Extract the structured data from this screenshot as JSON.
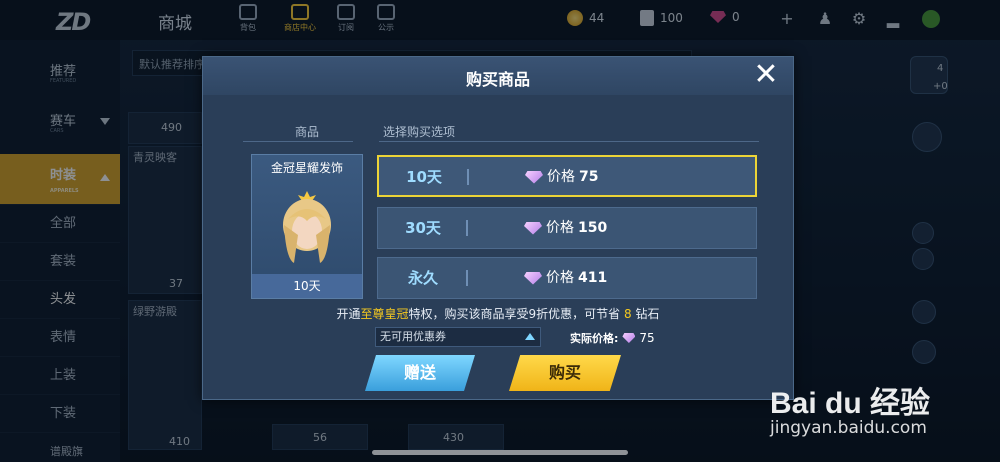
{
  "topbar": {
    "title": "商城",
    "tabs": [
      {
        "label": "背包"
      },
      {
        "label": "商店中心"
      },
      {
        "label": "订阅"
      },
      {
        "label": "公示"
      }
    ],
    "coins": "44",
    "tickets": "100",
    "diamonds": "0"
  },
  "sidebar": {
    "items": [
      {
        "label": "推荐",
        "sub": "FEATURED"
      },
      {
        "label": "赛车",
        "sub": "CARS"
      },
      {
        "label": "时装",
        "sub": "APPARELS"
      }
    ],
    "subitems": [
      "全部",
      "套装",
      "头发",
      "表情",
      "上装",
      "下装"
    ],
    "footer": "谱殿旗"
  },
  "background": {
    "search_hint": "默认推荐排序",
    "cards": [
      {
        "label": "青灵映客",
        "price": "37"
      },
      {
        "label": "绿野游殿",
        "price": "410"
      },
      {
        "price": "490"
      },
      {
        "price": "56"
      },
      {
        "price": "430"
      }
    ],
    "right_badge": "4",
    "right_badge_sub": "+0"
  },
  "modal": {
    "title": "购买商品",
    "col_item": "商品",
    "col_option": "选择购买选项",
    "item_name": "金冠星耀发饰",
    "item_duration": "10天",
    "options": [
      {
        "duration": "10天",
        "price_label": "价格",
        "price": "75",
        "selected": true
      },
      {
        "duration": "30天",
        "price_label": "价格",
        "price": "150",
        "selected": false
      },
      {
        "duration": "永久",
        "price_label": "价格",
        "price": "411",
        "selected": false
      }
    ],
    "promo": {
      "prefix": "开通",
      "highlight": "至尊皇冠",
      "middle": "特权，购买该商品享受9折优惠，可节省",
      "save": "8",
      "suffix": "钻石"
    },
    "coupon": "无可用优惠券",
    "actual_label": "实际价格:",
    "actual_price": "75",
    "gift_label": "赠送",
    "buy_label": "购买"
  },
  "watermark": {
    "brand": "Bai du 经验",
    "url": "jingyan.baidu.com"
  },
  "colors": {
    "accent": "#ecd437",
    "selected_side": "#d8a42a",
    "gift_button": "#3a9fdc",
    "buy_button": "#f0b418"
  }
}
